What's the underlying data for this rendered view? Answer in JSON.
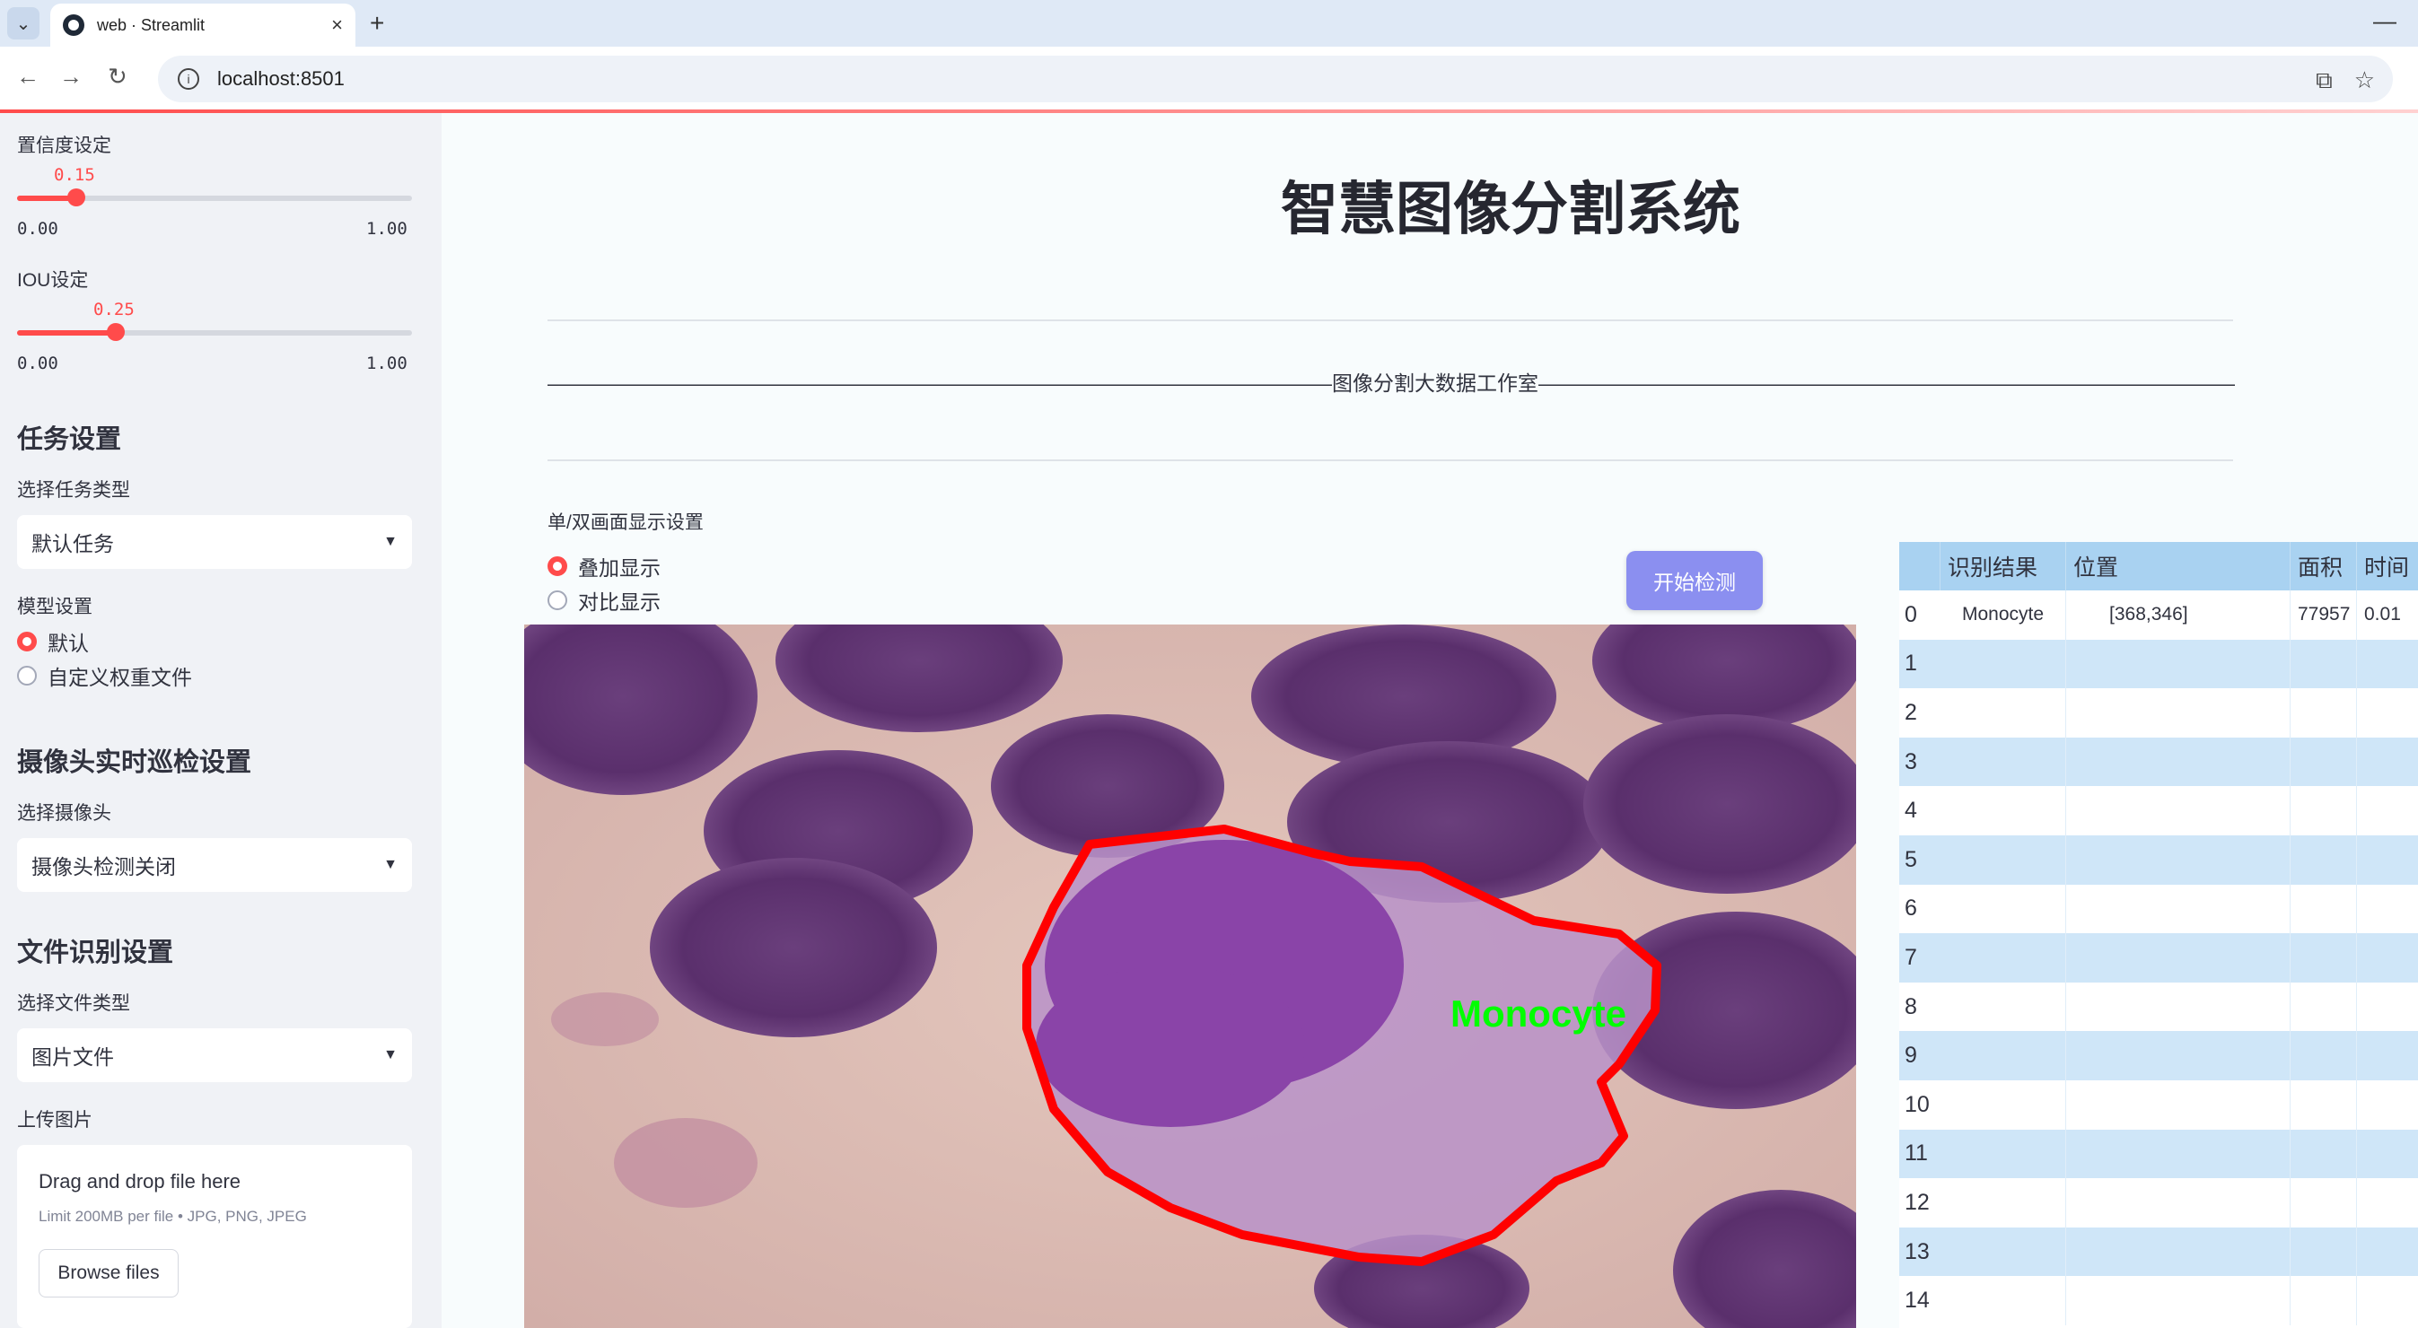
{
  "browser": {
    "tab_title": "web · Streamlit",
    "url": "localhost:8501",
    "new_tab": "+",
    "close": "×",
    "minimize": "—"
  },
  "sidebar": {
    "confidence": {
      "label": "置信度设定",
      "value": "0.15",
      "min": "0.00",
      "max": "1.00",
      "fraction": 0.15
    },
    "iou": {
      "label": "IOU设定",
      "value": "0.25",
      "min": "0.00",
      "max": "1.00",
      "fraction": 0.25
    },
    "task": {
      "heading": "任务设置",
      "select_label": "选择任务类型",
      "selected": "默认任务"
    },
    "model": {
      "label": "模型设置",
      "options": [
        "默认",
        "自定义权重文件"
      ],
      "selected_index": 0
    },
    "camera": {
      "heading": "摄像头实时巡检设置",
      "select_label": "选择摄像头",
      "selected": "摄像头检测关闭"
    },
    "file": {
      "heading": "文件识别设置",
      "select_label": "选择文件类型",
      "selected": "图片文件"
    },
    "upload": {
      "label": "上传图片",
      "drop_text": "Drag and drop file here",
      "limit_text": "Limit 200MB per file • JPG, PNG, JPEG",
      "browse": "Browse files"
    }
  },
  "main": {
    "title": "智慧图像分割系统",
    "subtitle": "——————————————————————————————————————图像分割大数据工作室——————————————————————————————————————",
    "display_label": "单/双画面显示设置",
    "display_options": [
      "叠加显示",
      "对比显示"
    ],
    "display_selected": 0,
    "start_button": "开始检测",
    "detection_label": "Monocyte"
  },
  "table": {
    "columns": [
      "识别结果",
      "位置",
      "面积",
      "时间"
    ],
    "rows": [
      {
        "idx": "0",
        "result": "Monocyte",
        "position": "[368,346]",
        "area": "77957",
        "time": "0.01"
      },
      {
        "idx": "1"
      },
      {
        "idx": "2"
      },
      {
        "idx": "3"
      },
      {
        "idx": "4"
      },
      {
        "idx": "5"
      },
      {
        "idx": "6"
      },
      {
        "idx": "7"
      },
      {
        "idx": "8"
      },
      {
        "idx": "9"
      },
      {
        "idx": "10"
      },
      {
        "idx": "11"
      },
      {
        "idx": "12"
      },
      {
        "idx": "13"
      },
      {
        "idx": "14"
      }
    ]
  },
  "colors": {
    "accent": "#ff4b4b",
    "sidebar_bg": "#f0f2f6",
    "table_header": "#a9d2f1",
    "table_alt": "#cfe6f8",
    "button": "#8b8ff0",
    "mask_outline": "#ff0000",
    "label_text": "#00ff00"
  }
}
